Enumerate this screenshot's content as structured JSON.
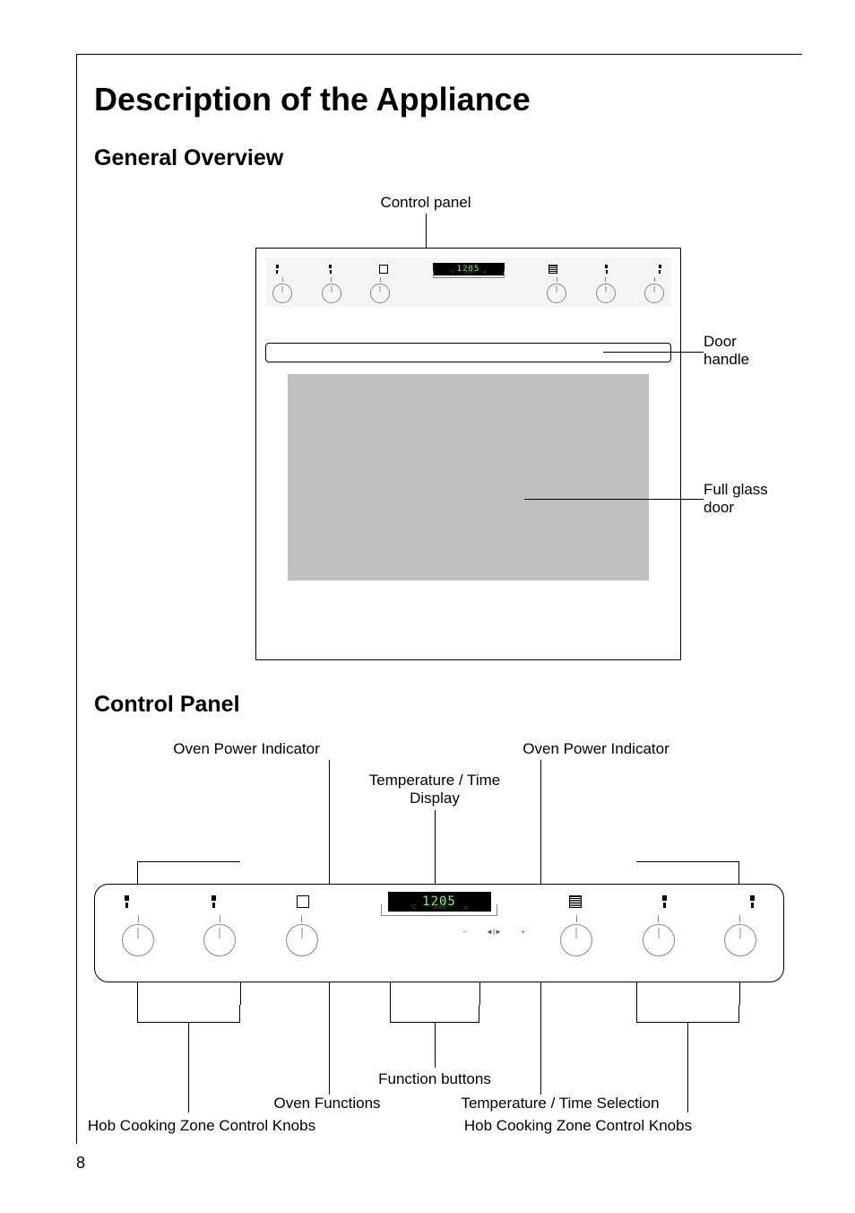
{
  "page_number": "8",
  "heading": "Description of the Appliance",
  "section1": {
    "title": "General Overview",
    "labels": {
      "control_panel": "Control panel",
      "door_handle": "Door\nhandle",
      "full_glass_door": "Full glass\ndoor"
    },
    "display_value": "1205"
  },
  "section2": {
    "title": "Control Panel",
    "labels": {
      "oven_power_indicator_left": "Oven Power Indicator",
      "oven_power_indicator_right": "Oven Power Indicator",
      "temp_time_display": "Temperature / Time\nDisplay",
      "function_buttons": "Function buttons",
      "oven_functions": "Oven Functions",
      "temp_time_selection": "Temperature / Time Selection",
      "hob_knobs_left": "Hob Cooking Zone Control Knobs",
      "hob_knobs_right": "Hob Cooking Zone Control Knobs"
    },
    "display_value": "1205",
    "sub_buttons": {
      "left": "°C",
      "mid": "0000",
      "right": "⊘"
    }
  }
}
